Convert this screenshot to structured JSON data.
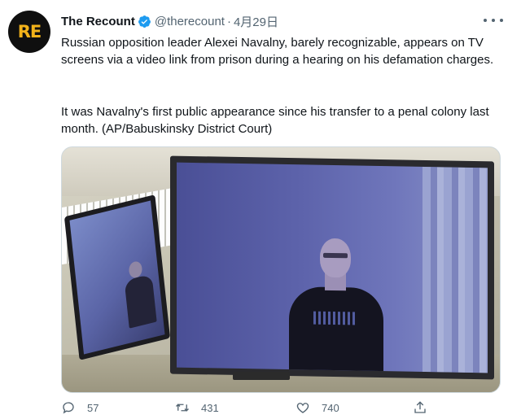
{
  "tweet": {
    "avatar_text": "RE",
    "display_name": "The Recount",
    "handle": "@therecount",
    "separator": "·",
    "date": "4月29日",
    "text_paragraph_1": "Russian opposition leader Alexei Navalny, barely recognizable, appears on TV screens via a video link from prison during a hearing on his defamation charges.",
    "text_paragraph_2": "It was Navalny's first public appearance since his transfer to a penal colony last month. (AP/Babuskinsky District Court)",
    "media_icon": "photo",
    "actions": {
      "reply_count": "57",
      "retweet_count": "431",
      "like_count": "740"
    },
    "icons": {
      "verified": "verified-badge-icon",
      "more": "more-icon",
      "reply": "reply-icon",
      "retweet": "retweet-icon",
      "like": "heart-icon",
      "share": "share-icon"
    },
    "colors": {
      "verified_blue": "#1d9bf0",
      "secondary_text": "#536471",
      "avatar_bg": "#0f0f0f",
      "avatar_letters": "#f2b21a"
    }
  }
}
